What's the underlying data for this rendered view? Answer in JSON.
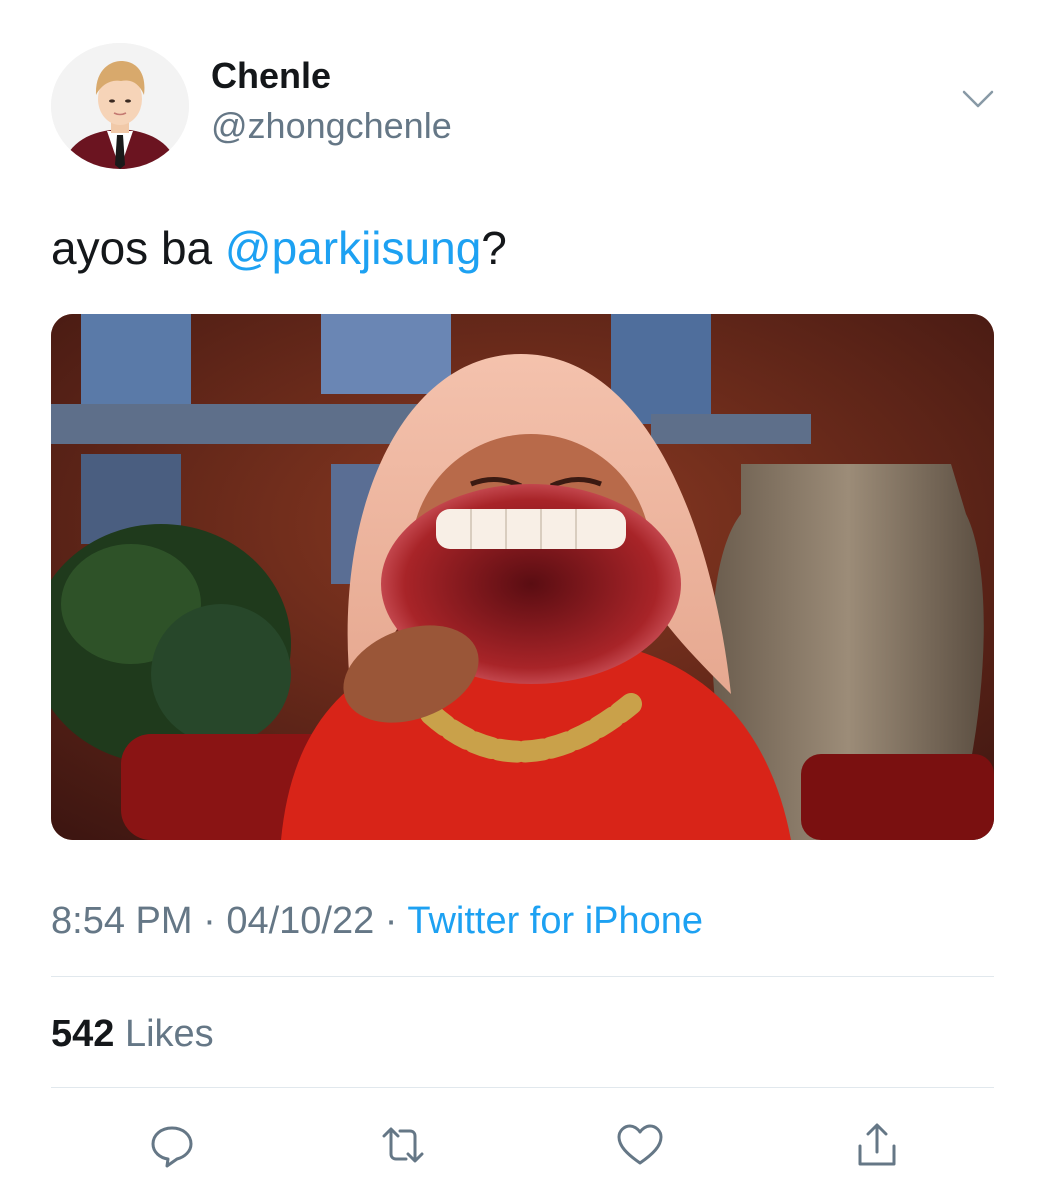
{
  "tweet": {
    "author": {
      "display_name": "Chenle",
      "handle": "@zhongchenle"
    },
    "text": {
      "before": "ayos ba ",
      "mention": "@parkjisung",
      "after": "?"
    },
    "meta": {
      "time": "8:54 PM",
      "sep1": " · ",
      "date": "04/10/22",
      "sep2": " · ",
      "source": "Twitter for iPhone"
    },
    "likes": {
      "count": "542",
      "label": " Likes"
    }
  },
  "icons": {
    "menu": "chevron-down-icon",
    "reply": "reply-icon",
    "retweet": "retweet-icon",
    "like": "heart-icon",
    "share": "share-icon"
  },
  "colors": {
    "accent": "#1da1f2",
    "secondary_text": "#657786",
    "primary_text": "#14171a",
    "divider": "#e1e8ed"
  }
}
